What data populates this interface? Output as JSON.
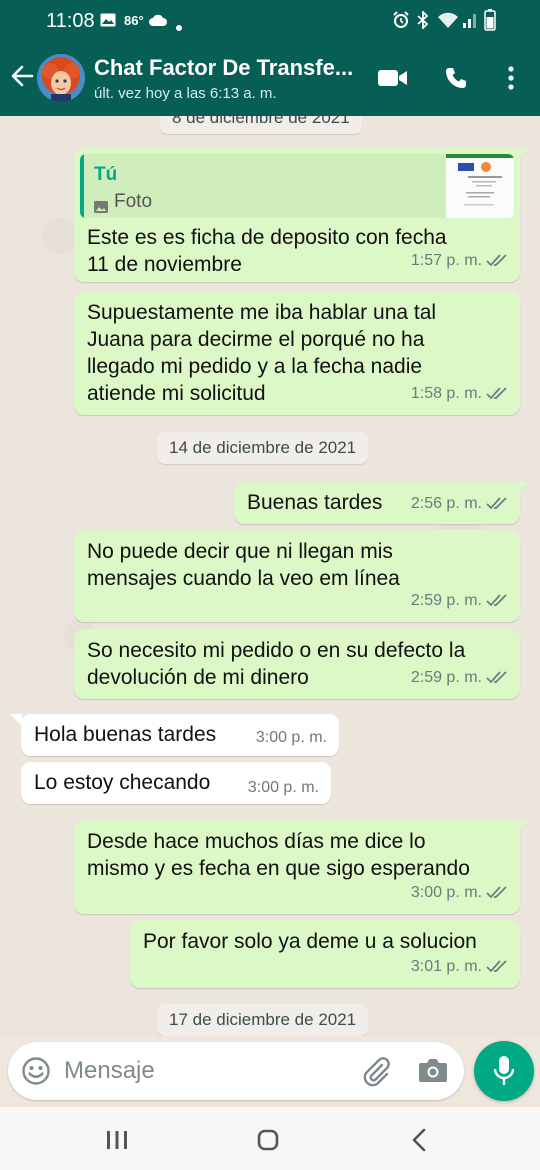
{
  "status_bar": {
    "time": "11:08",
    "temperature": "86°",
    "icons": [
      "gallery-icon",
      "cloud-icon",
      "alarm-icon",
      "bluetooth-icon",
      "wifi-icon",
      "signal-icon",
      "battery-icon"
    ]
  },
  "header": {
    "title": "Chat Factor De Transfe...",
    "subtitle": "últ. vez hoy a las 6:13 a. m.",
    "icons": [
      "back-arrow-icon",
      "video-call-icon",
      "phone-call-icon",
      "more-options-icon"
    ]
  },
  "chat": {
    "top_date_partial": "8 de diciembre de 2021",
    "reply_quote": {
      "author": "Tú",
      "type": "Foto"
    },
    "messages": [
      {
        "direction": "out",
        "lines": [
          "Este es es ficha de deposito con fecha",
          "11 de noviembre"
        ],
        "time": "1:57 p. m."
      },
      {
        "direction": "out",
        "lines": [
          "Supuestamente  me iba hablar  una tal",
          "Juana para decirme el porqué no ha",
          "llegado mi pedido y a la fecha nadie",
          "atiende mi solicitud"
        ],
        "time": "1:58 p. m."
      },
      {
        "direction": "out",
        "lines": [
          "Buenas tardes"
        ],
        "time": "2:56 p. m."
      },
      {
        "direction": "out",
        "lines": [
          "No puede decir que ni llegan mis",
          "mensajes cuando la veo em línea"
        ],
        "time": "2:59 p. m."
      },
      {
        "direction": "out",
        "lines": [
          "So necesito mi pedido o en su defecto la",
          "devolución de mi dinero"
        ],
        "time": "2:59 p. m."
      },
      {
        "direction": "in",
        "lines": [
          "Hola buenas tardes"
        ],
        "time": "3:00 p. m."
      },
      {
        "direction": "in",
        "lines": [
          "Lo estoy checando"
        ],
        "time": "3:00 p. m."
      },
      {
        "direction": "out",
        "lines": [
          "Desde hace muchos días me dice lo",
          "mismo y es fecha en que sigo esperando"
        ],
        "time": "3:00 p. m."
      },
      {
        "direction": "out",
        "lines": [
          "Por favor solo ya deme u a solucion"
        ],
        "time": "3:01 p. m."
      }
    ],
    "date_separators": [
      "14 de diciembre de 2021",
      "17 de diciembre de 2021"
    ]
  },
  "composer": {
    "placeholder": "Mensaje",
    "icons": [
      "emoji-icon",
      "attach-icon",
      "camera-icon",
      "mic-icon"
    ]
  },
  "nav_bar": {
    "icons": [
      "recent-apps-icon",
      "home-icon",
      "back-nav-icon"
    ]
  },
  "colors": {
    "header": "#075e54",
    "outgoing_bubble": "#dcf8c6",
    "incoming_bubble": "#ffffff",
    "accent": "#00a884",
    "read_ticks": "#6b7b7d"
  }
}
